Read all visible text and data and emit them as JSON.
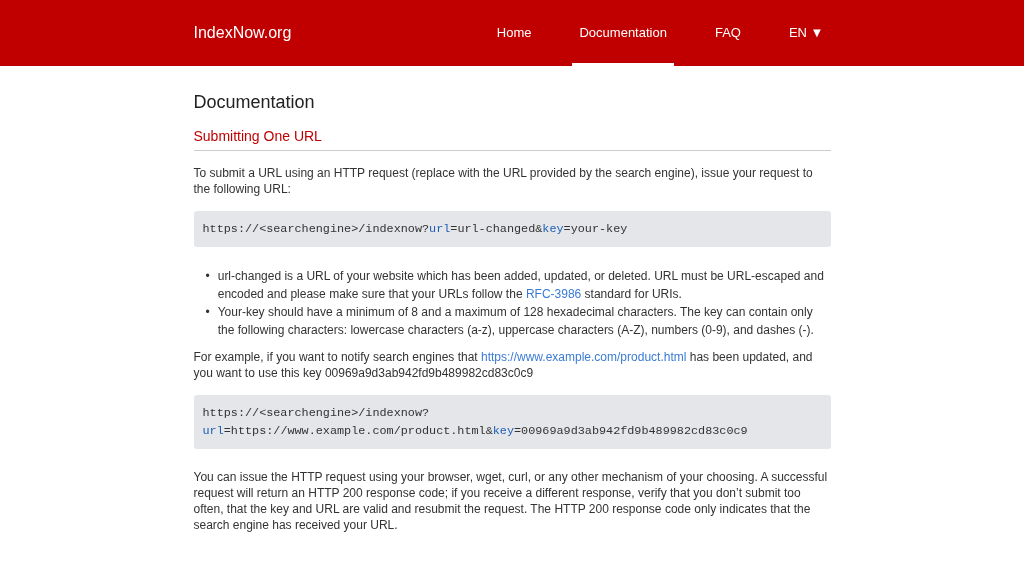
{
  "navbar": {
    "brand": "IndexNow.org",
    "links": [
      {
        "label": "Home",
        "selected": false
      },
      {
        "label": "Documentation",
        "selected": true
      },
      {
        "label": "FAQ",
        "selected": false
      }
    ],
    "language": {
      "label": "EN",
      "caret": "▼"
    }
  },
  "page_title": "Documentation",
  "section_title": "Submitting One URL",
  "content": [
    {
      "kind": "paragraph",
      "parts": [
        {
          "text": "To submit a URL using an HTTP request (replace with the URL provided by the search engine), issue your request to the following URL:"
        }
      ]
    },
    {
      "kind": "code",
      "lines": [
        [
          {
            "text": "https://<searchengine>/indexnow?"
          },
          {
            "param": "url"
          },
          {
            "text": "=url-changed&"
          },
          {
            "param": "key"
          },
          {
            "text": "=your-key"
          }
        ]
      ]
    },
    {
      "kind": "bullets",
      "items": [
        {
          "marker": "•",
          "parts": [
            {
              "text": "url-changed is a URL of your website which has been added, updated, or deleted. URL must be URL-escaped and encoded and please make sure that your URLs follow the "
            },
            {
              "link": "RFC-3986"
            },
            {
              "text": " standard for URIs."
            }
          ]
        },
        {
          "marker": "•",
          "parts": [
            {
              "text": "Your-key should have a minimum of 8 and a maximum of 128 hexadecimal characters. The key can contain only the following characters: lowercase characters (a-z), uppercase characters (A-Z), numbers (0-9), and dashes (-)."
            }
          ]
        }
      ]
    },
    {
      "kind": "paragraph",
      "parts": [
        {
          "text": "For example, if you want to notify search engines that "
        },
        {
          "link": "https://www.example.com/product.html"
        },
        {
          "text": " has been updated, and you want to use this key 00969a9d3ab942fd9b489982cd83c0c9"
        }
      ]
    },
    {
      "kind": "code",
      "lines": [
        [
          {
            "text": "https://<searchengine>/indexnow?"
          }
        ],
        [
          {
            "param": "url"
          },
          {
            "text": "=https://www.example.com/product.html&"
          },
          {
            "param": "key"
          },
          {
            "text": "=00969a9d3ab942fd9b489982cd83c0c9"
          }
        ]
      ]
    },
    {
      "kind": "paragraph",
      "parts": [
        {
          "text": "You can issue the HTTP request using your browser, wget, curl, or any other mechanism of your choosing. A successful request will return an HTTP 200 response code; if you receive a different response, verify that you don’t submit too often, that the key and URL are valid and resubmit the request. The HTTP 200 response code only indicates that the search engine has received your URL."
        }
      ]
    }
  ]
}
